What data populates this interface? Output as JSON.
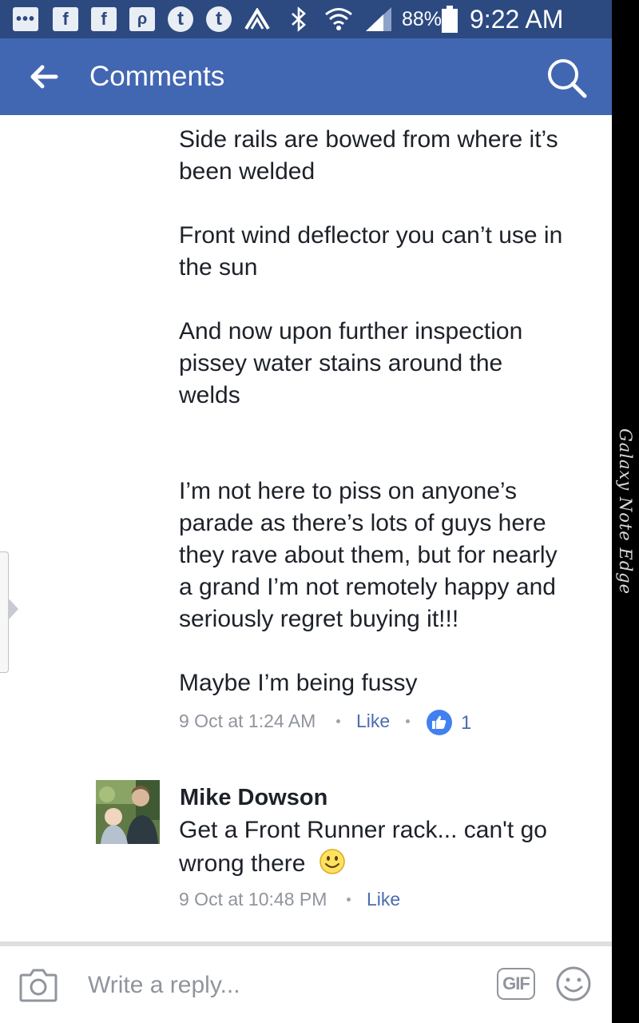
{
  "status_bar": {
    "notification_icons": [
      "more-notifications-icon",
      "facebook-icon",
      "facebook-icon",
      "pinterest-icon",
      "tumblr-icon",
      "tumblr-icon",
      "app-a-icon"
    ],
    "battery": "88%",
    "time": "9:22 AM"
  },
  "app_bar": {
    "title": "Comments",
    "back_icon": "arrow-left-icon",
    "search_icon": "search-icon",
    "background": "#4267b2"
  },
  "comments": [
    {
      "paragraphs": [
        [
          "Side rails are bowed from where it’s",
          "been welded"
        ],
        [
          "Front wind deflector you can’t use in",
          "the sun"
        ],
        [
          "And now upon further inspection",
          "pissey water stains around the",
          "welds"
        ],
        [
          "I’m not here to piss on anyone’s",
          "parade as there’s lots of guys here",
          "they rave about them, but for nearly",
          "a grand I’m not remotely happy and",
          "seriously regret buying it!!!"
        ],
        [
          "Maybe I’m being fussy"
        ]
      ],
      "timestamp": "9 Oct at 1:24 AM",
      "like_label": "Like",
      "reaction_count": "1"
    },
    {
      "author": "Mike Dowson",
      "lines": [
        "Get a Front Runner rack... can't go",
        "wrong there"
      ],
      "emoji": "smiley-icon",
      "timestamp": "9 Oct at 10:48 PM",
      "like_label": "Like"
    }
  ],
  "composer": {
    "placeholder": "Write a reply...",
    "gif_label": "GIF",
    "camera_icon": "camera-icon",
    "emoji_icon": "emoji-icon"
  },
  "device_edge": {
    "brand_text": "Galaxy Note Edge"
  },
  "colors": {
    "status_bar": "#2c4a80",
    "link": "#4b6cb0",
    "like_reaction": "#4280f0",
    "meta_text": "#90949c"
  }
}
